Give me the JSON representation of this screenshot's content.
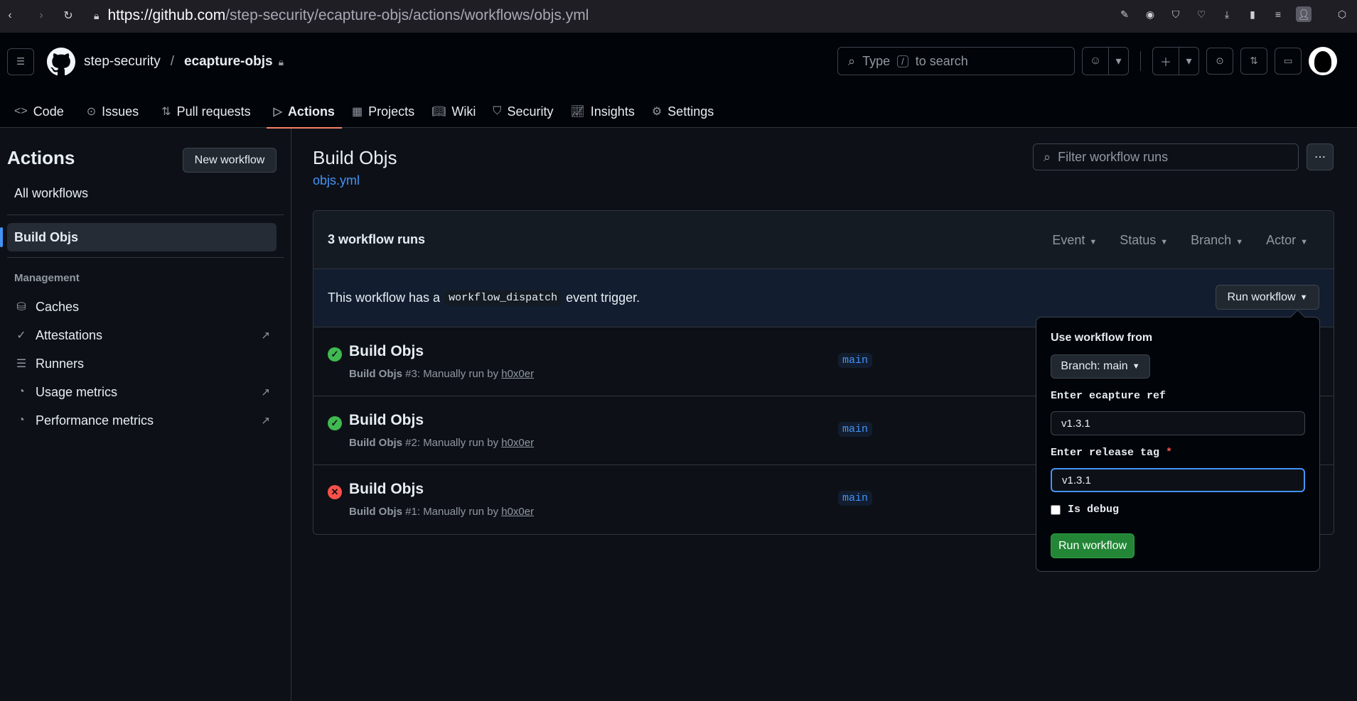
{
  "browser": {
    "url_host": "https://github.com",
    "url_path": "/step-security/ecapture-objs/actions/workflows/objs.yml"
  },
  "header": {
    "owner": "step-security",
    "repo": "ecapture-objs",
    "search_type": "Type",
    "search_key": "/",
    "search_rest": "to search"
  },
  "tabs": [
    {
      "label": "Code",
      "icon": "code-icon"
    },
    {
      "label": "Issues",
      "icon": "issue-icon"
    },
    {
      "label": "Pull requests",
      "icon": "pull-request-icon"
    },
    {
      "label": "Actions",
      "icon": "play-icon",
      "active": true
    },
    {
      "label": "Projects",
      "icon": "table-icon"
    },
    {
      "label": "Wiki",
      "icon": "book-icon"
    },
    {
      "label": "Security",
      "icon": "shield-icon"
    },
    {
      "label": "Insights",
      "icon": "graph-icon"
    },
    {
      "label": "Settings",
      "icon": "gear-icon"
    }
  ],
  "sidebar": {
    "title": "Actions",
    "new_workflow": "New workflow",
    "all_workflows": "All workflows",
    "active_workflow": "Build Objs",
    "management": "Management",
    "items": [
      {
        "label": "Caches",
        "icon": "database-icon"
      },
      {
        "label": "Attestations",
        "icon": "verified-icon"
      },
      {
        "label": "Runners",
        "icon": "server-icon"
      },
      {
        "label": "Usage metrics",
        "icon": "meter-icon"
      },
      {
        "label": "Performance metrics",
        "icon": "meter-icon"
      }
    ]
  },
  "main": {
    "title": "Build Objs",
    "file": "objs.yml",
    "filter_placeholder": "Filter workflow runs",
    "runs_count": "3 workflow runs",
    "filters": [
      "Event",
      "Status",
      "Branch",
      "Actor"
    ],
    "trigger_pre": "This workflow has a",
    "trigger_code": "workflow_dispatch",
    "trigger_post": "event trigger.",
    "run_workflow": "Run workflow",
    "runs": [
      {
        "title": "Build Objs",
        "name": "Build Objs",
        "meta": "#3: Manually run by",
        "user": "h0x0er",
        "branch": "main",
        "status": "success"
      },
      {
        "title": "Build Objs",
        "name": "Build Objs",
        "meta": "#2: Manually run by",
        "user": "h0x0er",
        "branch": "main",
        "status": "success"
      },
      {
        "title": "Build Objs",
        "name": "Build Objs",
        "meta": "#1: Manually run by",
        "user": "h0x0er",
        "branch": "main",
        "status": "failure"
      }
    ]
  },
  "popup": {
    "use_from": "Use workflow from",
    "branch_select": "Branch: main",
    "ref_label": "Enter ecapture ref",
    "ref_value": "v1.3.1",
    "tag_label": "Enter release tag",
    "tag_required": "*",
    "tag_value": "v1.3.1",
    "debug_label": "Is debug",
    "run_button": "Run workflow"
  }
}
